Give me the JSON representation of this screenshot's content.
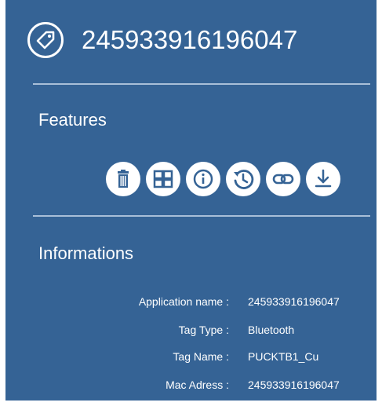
{
  "header": {
    "title": "245933916196047",
    "icon": "tag-icon"
  },
  "features": {
    "heading": "Features",
    "actions": [
      {
        "icon": "trash-icon"
      },
      {
        "icon": "grid-icon"
      },
      {
        "icon": "info-icon"
      },
      {
        "icon": "history-icon"
      },
      {
        "icon": "link-icon"
      },
      {
        "icon": "download-icon"
      }
    ]
  },
  "informations": {
    "heading": "Informations",
    "rows": [
      {
        "label": "Application name :",
        "value": "245933916196047"
      },
      {
        "label": "Tag Type :",
        "value": "Bluetooth"
      },
      {
        "label": "Tag Name :",
        "value": "PUCKTB1_Cu"
      },
      {
        "label": "Mac Adress :",
        "value": "245933916196047"
      }
    ]
  },
  "colors": {
    "panel_background": "#356395",
    "text": "#ffffff",
    "divider": "#a9bfd8",
    "icon_fill": "#356395"
  }
}
